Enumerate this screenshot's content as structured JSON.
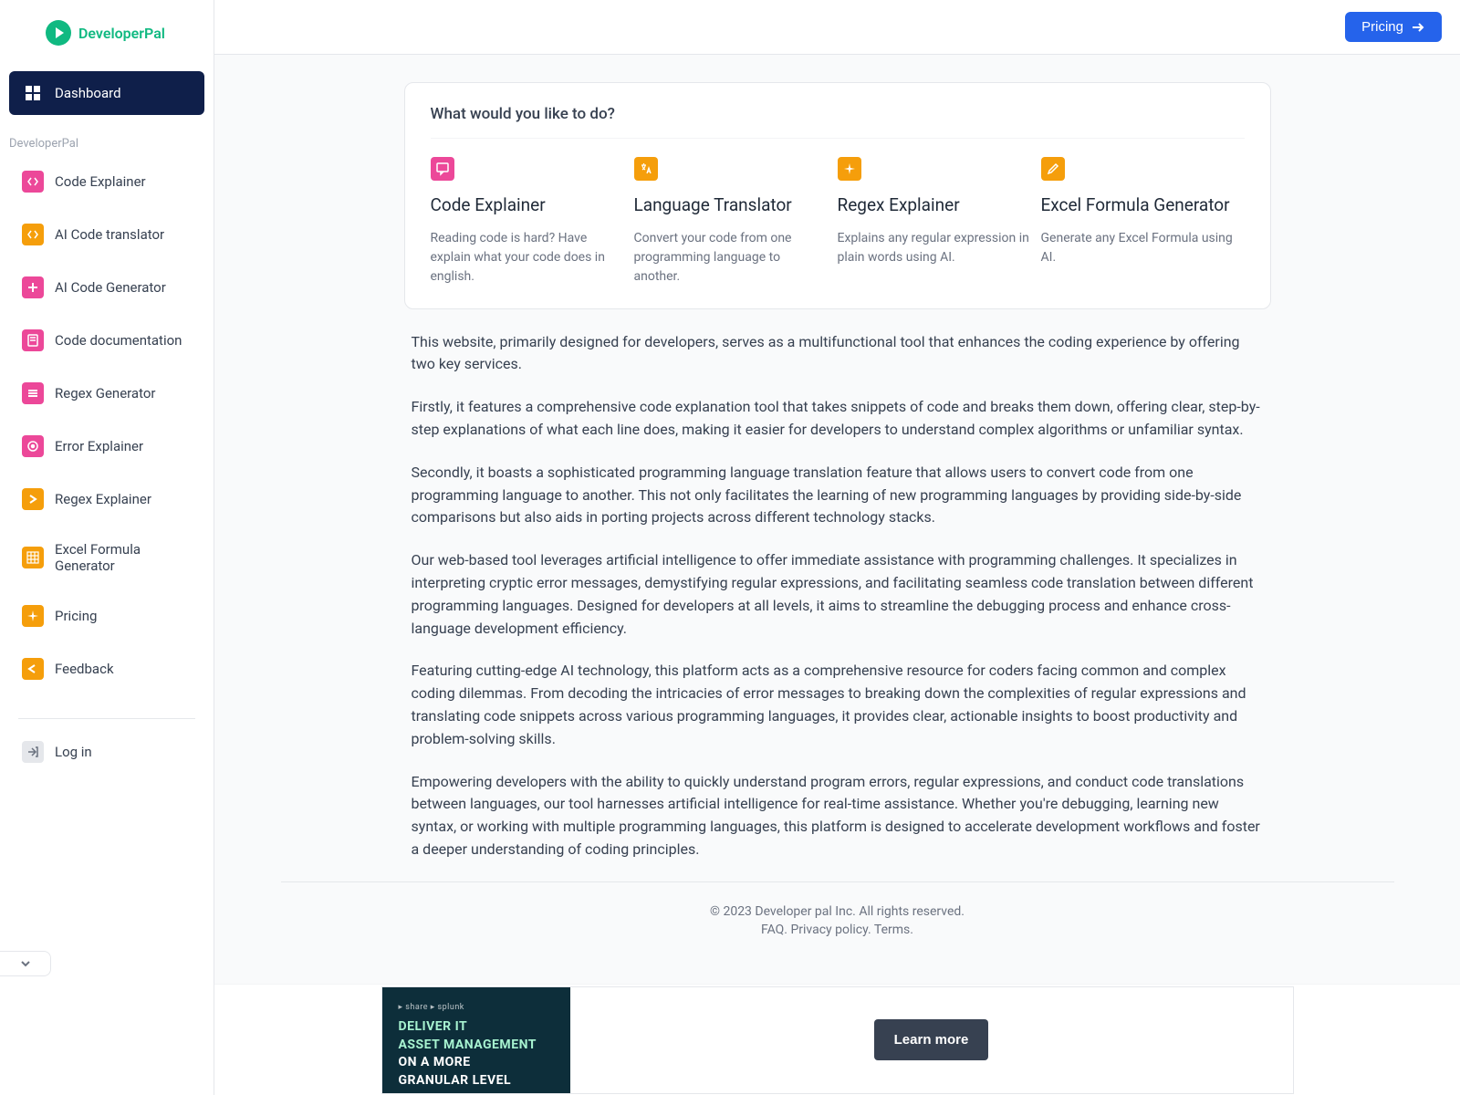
{
  "logo": {
    "text": "DeveloperPal"
  },
  "topbar": {
    "pricing": "Pricing"
  },
  "sidebar": {
    "dashboard": "Dashboard",
    "section_label": "DeveloperPal",
    "items": [
      {
        "label": "Code Explainer"
      },
      {
        "label": "AI Code translator"
      },
      {
        "label": "AI Code Generator"
      },
      {
        "label": "Code documentation"
      },
      {
        "label": "Regex Generator"
      },
      {
        "label": "Error Explainer"
      },
      {
        "label": "Regex Explainer"
      },
      {
        "label": "Excel Formula Generator"
      },
      {
        "label": "Pricing"
      },
      {
        "label": "Feedback"
      }
    ],
    "login": "Log in"
  },
  "card": {
    "title": "What would you like to do?",
    "features": [
      {
        "title": "Code Explainer",
        "desc": "Reading code is hard? Have explain what your code does in english."
      },
      {
        "title": "Language Translator",
        "desc": "Convert your code from one programming language to another."
      },
      {
        "title": "Regex Explainer",
        "desc": "Explains any regular expression in plain words using AI."
      },
      {
        "title": "Excel Formula Generator",
        "desc": "Generate any Excel Formula using AI."
      }
    ]
  },
  "paragraphs": [
    "This website, primarily designed for developers, serves as a multifunctional tool that enhances the coding experience by offering two key services.",
    "Firstly, it features a comprehensive code explanation tool that takes snippets of code and breaks them down, offering clear, step-by-step explanations of what each line does, making it easier for developers to understand complex algorithms or unfamiliar syntax.",
    "Secondly, it boasts a sophisticated programming language translation feature that allows users to convert code from one programming language to another. This not only facilitates the learning of new programming languages by providing side-by-side comparisons but also aids in porting projects across different technology stacks.",
    "Our web-based tool leverages artificial intelligence to offer immediate assistance with programming challenges. It specializes in interpreting cryptic error messages, demystifying regular expressions, and facilitating seamless code translation between different programming languages. Designed for developers at all levels, it aims to streamline the debugging process and enhance cross-language development efficiency.",
    "Featuring cutting-edge AI technology, this platform acts as a comprehensive resource for coders facing common and complex coding dilemmas. From decoding the intricacies of error messages to breaking down the complexities of regular expressions and translating code snippets across various programming languages, it provides clear, actionable insights to boost productivity and problem-solving skills.",
    "Empowering developers with the ability to quickly understand program errors, regular expressions, and conduct code translations between languages, our tool harnesses artificial intelligence for real-time assistance. Whether you're debugging, learning new syntax, or working with multiple programming languages, this platform is designed to accelerate development workflows and foster a deeper understanding of coding principles."
  ],
  "footer": {
    "copyright": "© 2023 Developer pal Inc. All rights reserved.",
    "links": {
      "faq": "FAQ",
      "privacy": "Privacy policy",
      "terms": "Terms"
    }
  },
  "ad": {
    "headline_line1": "DELIVER IT",
    "headline_line2": "ASSET MANAGEMENT",
    "headline_line3": "ON A MORE",
    "headline_line4": "GRANULAR LEVEL",
    "cta": "Learn more"
  }
}
